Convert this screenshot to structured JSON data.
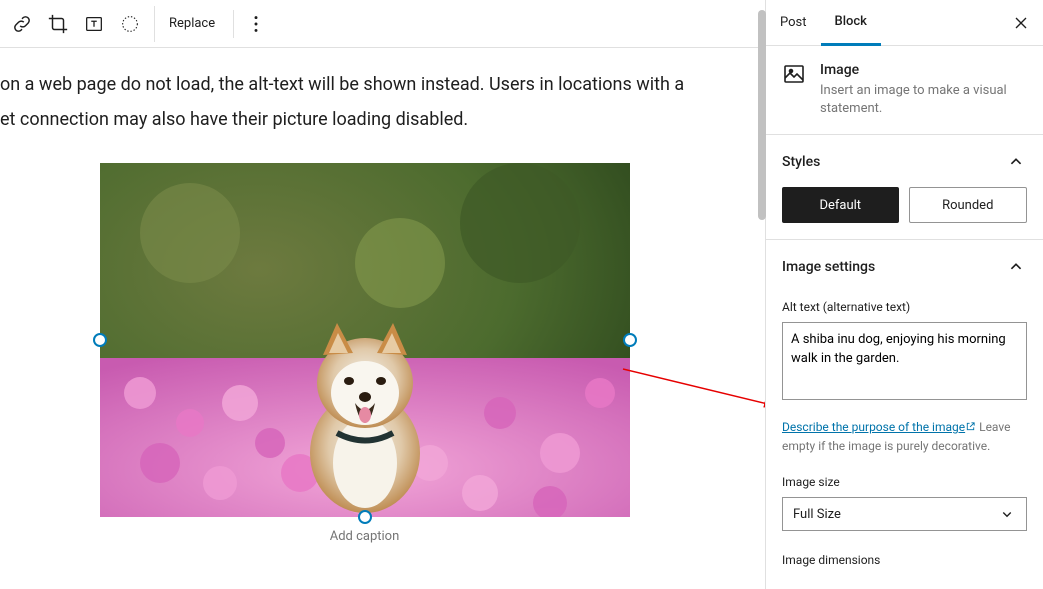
{
  "toolbar": {
    "replace_label": "Replace"
  },
  "body": {
    "line1": " on a web page do not load, the alt-text will be shown instead. Users in locations with a",
    "line2": "et connection may also have their picture loading disabled.",
    "caption_placeholder": "Add caption"
  },
  "sidebar": {
    "tabs": {
      "post": "Post",
      "block": "Block"
    },
    "block_card": {
      "title": "Image",
      "desc": "Insert an image to make a visual statement."
    },
    "styles": {
      "title": "Styles",
      "default": "Default",
      "rounded": "Rounded"
    },
    "image_settings": {
      "title": "Image settings",
      "alt_label": "Alt text (alternative text)",
      "alt_value": "A shiba inu dog, enjoying his morning walk in the garden.",
      "help_link": "Describe the purpose of the image",
      "help_rest": " Leave empty if the image is purely decorative.",
      "size_label": "Image size",
      "size_value": "Full Size",
      "dimensions_label": "Image dimensions"
    }
  }
}
